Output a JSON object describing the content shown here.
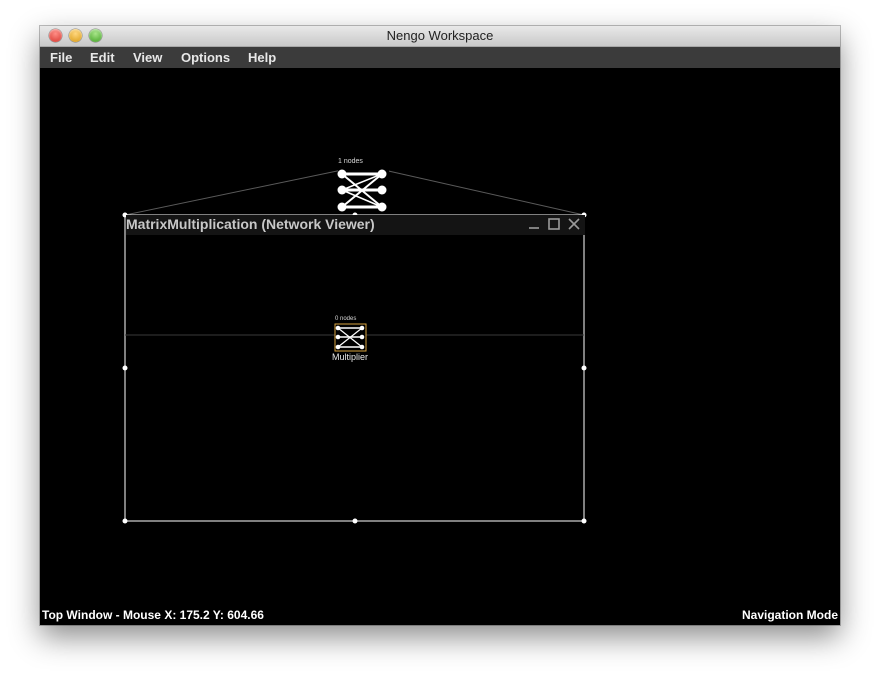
{
  "window": {
    "title": "Nengo Workspace"
  },
  "menu": [
    "File",
    "Edit",
    "View",
    "Options",
    "Help"
  ],
  "network_viewer": {
    "title": "MatrixMultiplication (Network Viewer)",
    "controls": [
      "minimize-icon",
      "maximize-icon",
      "close-icon"
    ]
  },
  "top_network": {
    "node_count": "1 nodes"
  },
  "inner_network": {
    "node_count": "0 nodes",
    "label": "Multiplier"
  },
  "status": {
    "left": "Top Window - Mouse X: 175.2 Y: 604.66",
    "right": "Navigation Mode"
  },
  "colors": {
    "background": "#000000",
    "menubar": "#3b3b3b",
    "selection": "#ffffff",
    "inner_node_border": "#d9a441"
  }
}
